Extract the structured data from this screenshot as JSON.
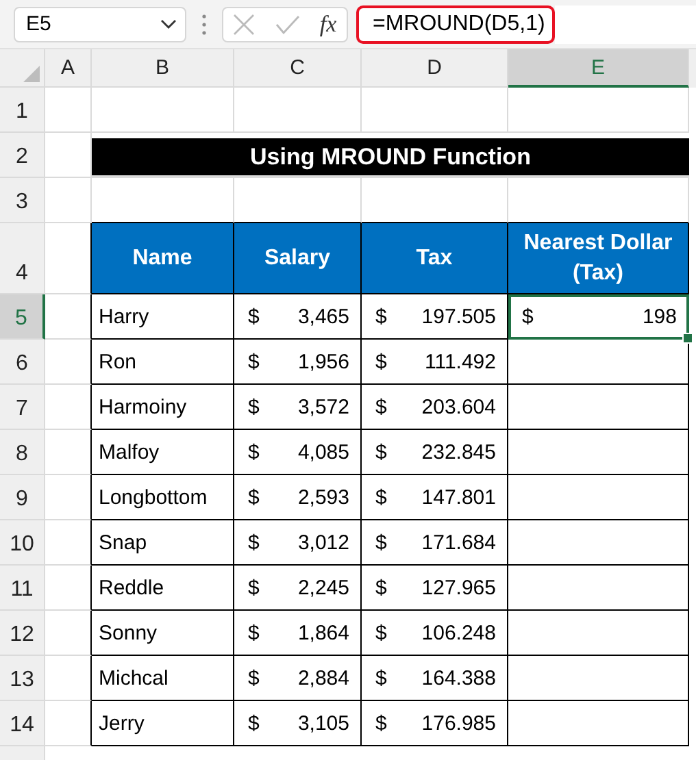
{
  "formula_bar": {
    "name_box": "E5",
    "function_icon_label": "fx",
    "formula": "=MROUND(D5,1)"
  },
  "columns": [
    {
      "label": "A",
      "selected": false
    },
    {
      "label": "B",
      "selected": false
    },
    {
      "label": "C",
      "selected": false
    },
    {
      "label": "D",
      "selected": false
    },
    {
      "label": "E",
      "selected": true
    }
  ],
  "sheet_rows": [
    {
      "number": "1",
      "selected": false,
      "kind": "blank"
    },
    {
      "number": "2",
      "selected": false,
      "kind": "title",
      "title": "Using MROUND Function"
    },
    {
      "number": "3",
      "selected": false,
      "kind": "blank"
    },
    {
      "number": "4",
      "selected": false,
      "kind": "header",
      "cells": [
        "Name",
        "Salary",
        "Tax",
        "Nearest Dollar (Tax)"
      ]
    },
    {
      "number": "5",
      "selected": true,
      "kind": "data",
      "name": "Harry",
      "salary": {
        "currency": "$",
        "amount": "3,465"
      },
      "tax": {
        "currency": "$",
        "amount": "197.505"
      },
      "nearest": {
        "currency": "$",
        "amount": "198"
      }
    },
    {
      "number": "6",
      "selected": false,
      "kind": "data",
      "name": "Ron",
      "salary": {
        "currency": "$",
        "amount": "1,956"
      },
      "tax": {
        "currency": "$",
        "amount": "111.492"
      }
    },
    {
      "number": "7",
      "selected": false,
      "kind": "data",
      "name": "Harmoiny",
      "salary": {
        "currency": "$",
        "amount": "3,572"
      },
      "tax": {
        "currency": "$",
        "amount": "203.604"
      }
    },
    {
      "number": "8",
      "selected": false,
      "kind": "data",
      "name": "Malfoy",
      "salary": {
        "currency": "$",
        "amount": "4,085"
      },
      "tax": {
        "currency": "$",
        "amount": "232.845"
      }
    },
    {
      "number": "9",
      "selected": false,
      "kind": "data",
      "name": "Longbottom",
      "salary": {
        "currency": "$",
        "amount": "2,593"
      },
      "tax": {
        "currency": "$",
        "amount": "147.801"
      }
    },
    {
      "number": "10",
      "selected": false,
      "kind": "data",
      "name": "Snap",
      "salary": {
        "currency": "$",
        "amount": "3,012"
      },
      "tax": {
        "currency": "$",
        "amount": "171.684"
      }
    },
    {
      "number": "11",
      "selected": false,
      "kind": "data",
      "name": "Reddle",
      "salary": {
        "currency": "$",
        "amount": "2,245"
      },
      "tax": {
        "currency": "$",
        "amount": "127.965"
      }
    },
    {
      "number": "12",
      "selected": false,
      "kind": "data",
      "name": "Sonny",
      "salary": {
        "currency": "$",
        "amount": "1,864"
      },
      "tax": {
        "currency": "$",
        "amount": "106.248"
      }
    },
    {
      "number": "13",
      "selected": false,
      "kind": "data",
      "name": "Michcal",
      "salary": {
        "currency": "$",
        "amount": "2,884"
      },
      "tax": {
        "currency": "$",
        "amount": "164.388"
      }
    },
    {
      "number": "14",
      "selected": false,
      "kind": "data",
      "name": "Jerry",
      "salary": {
        "currency": "$",
        "amount": "3,105"
      },
      "tax": {
        "currency": "$",
        "amount": "176.985"
      }
    }
  ]
}
